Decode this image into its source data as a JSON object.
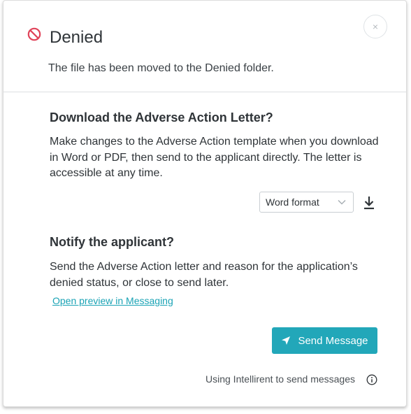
{
  "modal": {
    "close_glyph": "×",
    "title": "Denied",
    "subtitle": "The file has been moved to the Denied folder."
  },
  "download_section": {
    "heading": "Download the Adverse Action Letter?",
    "description": "Make changes to the Adverse Action template when you download in Word or PDF, then send to the applicant directly. The letter is accessible at any time.",
    "format_select": {
      "selected": "Word format"
    }
  },
  "notify_section": {
    "heading": "Notify the applicant?",
    "description": "Send the Adverse Action letter and reason for the application’s denied status, or close to send later.",
    "preview_link": "Open preview in Messaging",
    "send_button": "Send Message"
  },
  "footer": {
    "note": "Using Intellirent to send messages"
  },
  "colors": {
    "denied_red": "#e0445a",
    "accent_teal": "#22a7b9",
    "link_teal": "#1aa3b5"
  },
  "icons": [
    "denied-icon",
    "close-icon",
    "chevron-down-icon",
    "download-icon",
    "paper-plane-icon",
    "info-icon"
  ]
}
